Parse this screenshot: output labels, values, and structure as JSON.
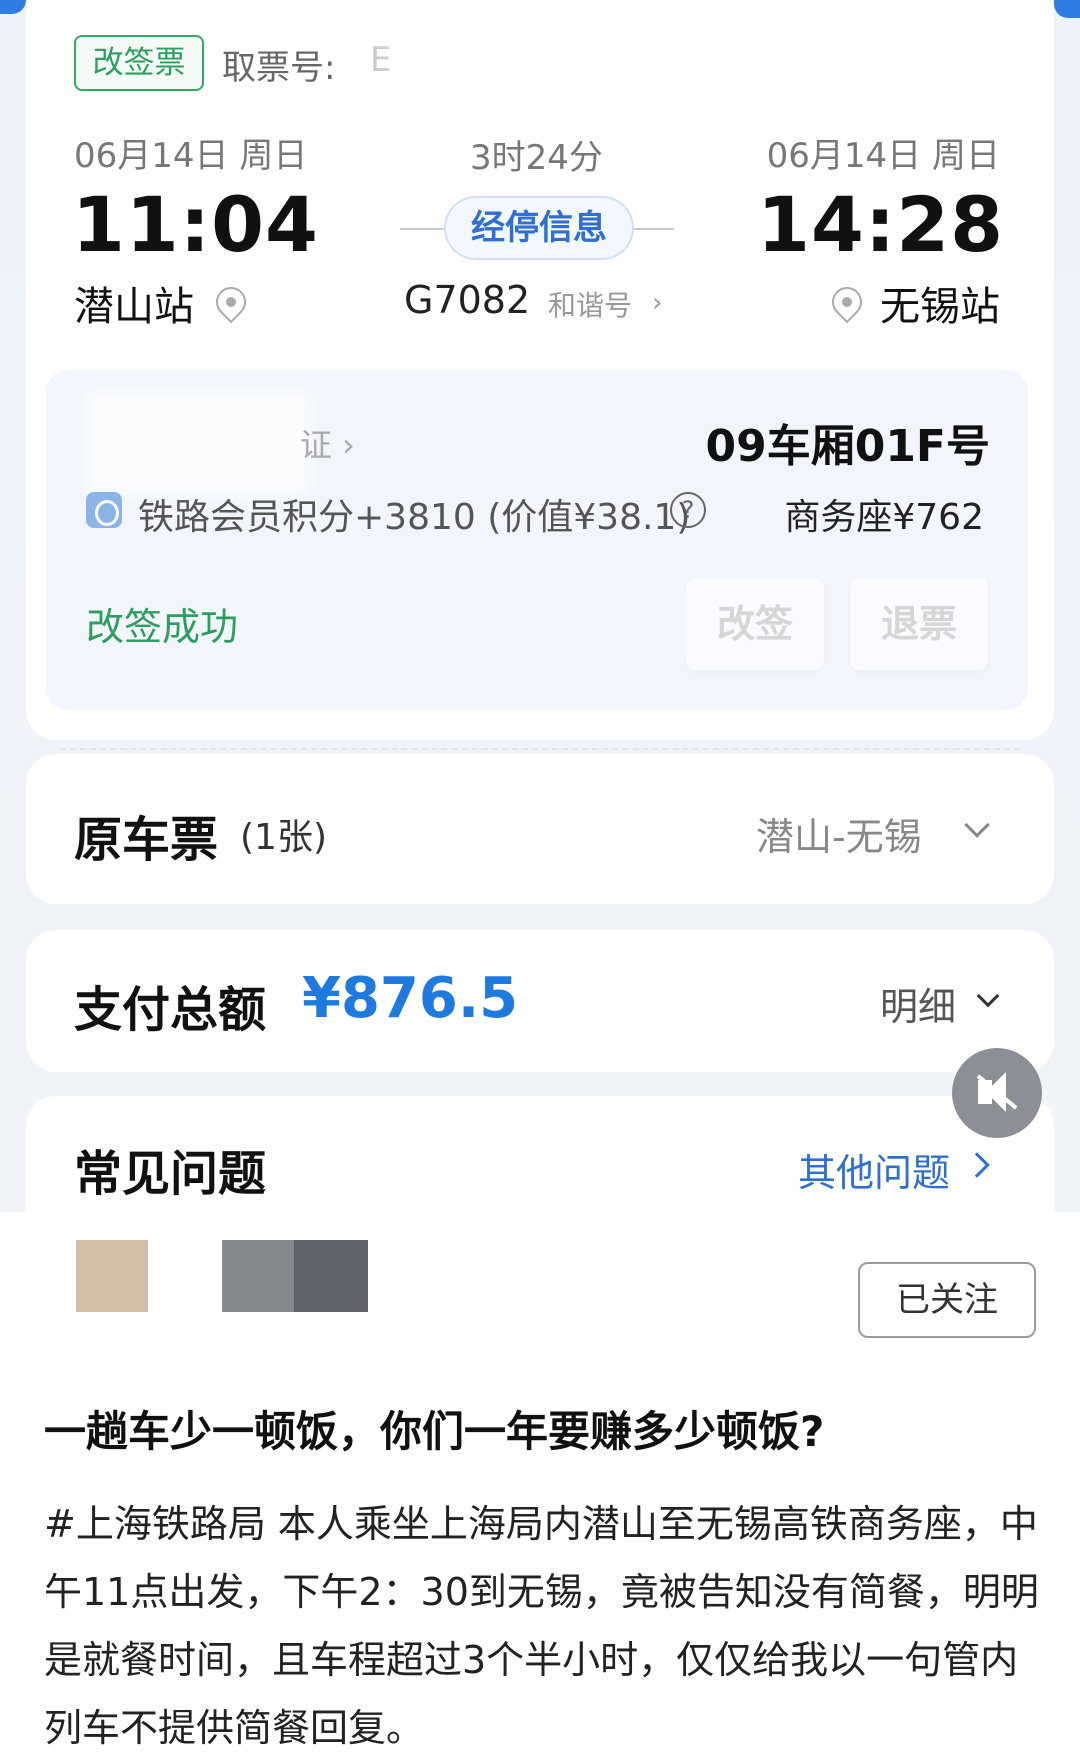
{
  "ticket": {
    "tag": "改签票",
    "ticket_no_label": "取票号:",
    "ticket_no_fragment": "E",
    "depart_date": "06月14日 周日",
    "arrive_date": "06月14日 周日",
    "duration": "3时24分",
    "depart_time": "11:04",
    "arrive_time": "14:28",
    "stops_button": "经停信息",
    "depart_station": "潜山站",
    "arrive_station": "无锡站",
    "train_no": "G7082",
    "train_type": "和谐号",
    "train_type_arrow": "›"
  },
  "passenger": {
    "id_link": "证 ›",
    "seat": "09车厢01F号",
    "points": "铁路会员积分+3810 (价值¥38.1)",
    "help_icon": "?",
    "seat_price": "商务座¥762",
    "status": "改签成功",
    "change_button": "改签",
    "refund_button": "退票"
  },
  "original_ticket": {
    "title": "原车票",
    "count": "(1张)",
    "route": "潜山-无锡"
  },
  "payment": {
    "title": "支付总额",
    "amount": "¥876.5",
    "detail": "明细"
  },
  "faq": {
    "title": "常见问题",
    "link": "其他问题"
  },
  "post": {
    "follow_button": "已关注",
    "title": "一趟车少一顿饭，你们一年要赚多少顿饭?",
    "body": "#上海铁路局 本人乘坐上海局内潜山至无锡高铁商务座，中午11点出发，下午2：30到无锡，竟被告知没有简餐，明明是就餐时间，且车程超过3个半小时，仅仅给我以一句管内列车不提供简餐回复。"
  },
  "icons": {
    "pin": "location-pin-icon",
    "points": "points-coin-icon",
    "mute": "mute-icon",
    "chevron": "chevron-icon"
  },
  "colors": {
    "accent_blue": "#1f7ae0",
    "success_green": "#2e9e5e",
    "background": "#eef3fa"
  }
}
